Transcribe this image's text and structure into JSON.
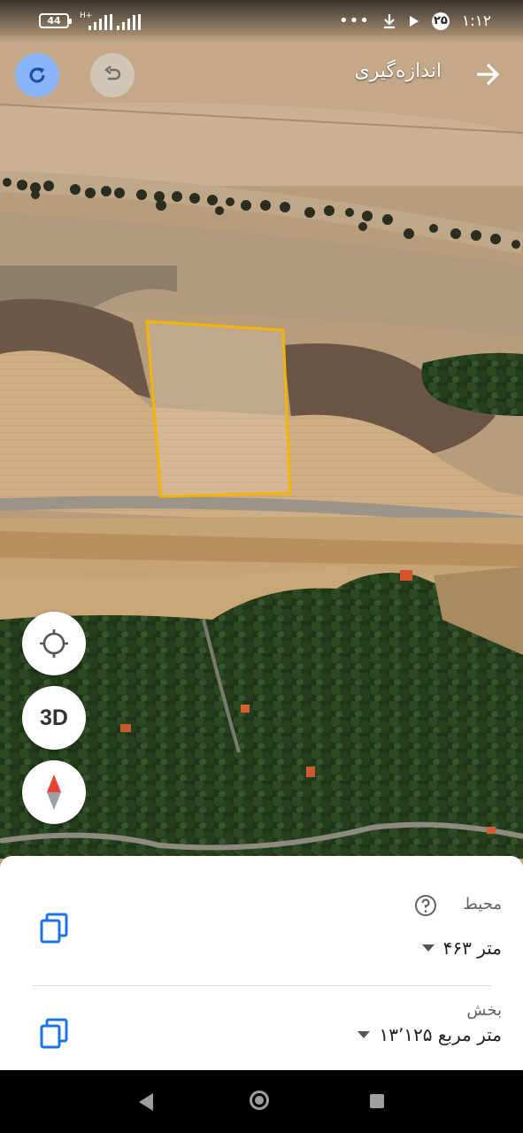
{
  "status_bar": {
    "battery": "44",
    "network": "H+",
    "time": "۱:۱۲",
    "badge": "۲۵"
  },
  "header": {
    "title": "اندازه‌گیری"
  },
  "map_controls": {
    "three_d_label": "3D"
  },
  "measurements": {
    "perimeter_label": "محیط",
    "perimeter_value": "۴۶۳ متر",
    "area_label": "بخش",
    "area_value": "۱۳٬۱۲۵ متر مربع"
  },
  "colors": {
    "selection_polygon": "#f4b400",
    "accent_blue": "#1a73e8",
    "rotate_button": "#8ab4f8"
  }
}
